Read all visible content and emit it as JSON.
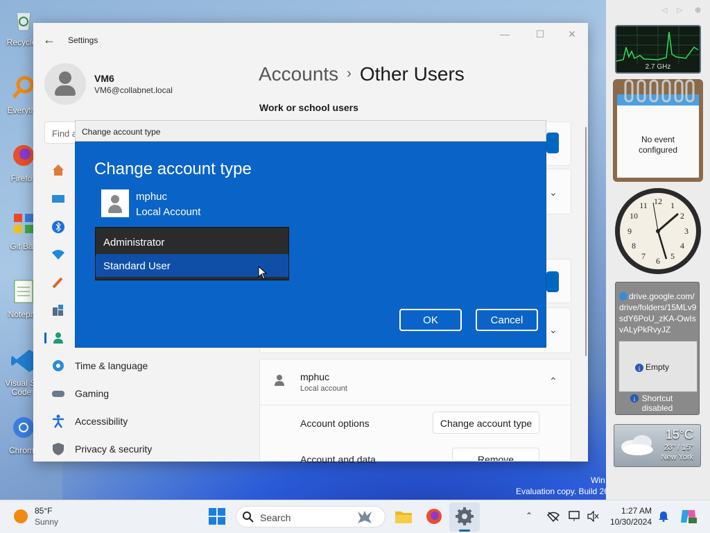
{
  "desktop": {
    "icons": [
      {
        "label": "Recycle",
        "color": "#e6e6e6"
      },
      {
        "label": "Everyth",
        "color": "#f08a12"
      },
      {
        "label": "Firefo",
        "color": "#e8502a"
      },
      {
        "label": "Git Ba",
        "color": "#3c7fd8"
      },
      {
        "label": "Notepa",
        "color": "#5aa03c"
      },
      {
        "label": "Visual St Code",
        "color": "#1e7fd0"
      },
      {
        "label": "Chrom",
        "color": "#3b7ee0"
      }
    ],
    "watermark_line1": "Win",
    "watermark_line2": "Evaluation copy. Build 26"
  },
  "window": {
    "title": "Settings",
    "controls": {
      "minimize": "—",
      "maximize": "☐",
      "close": "✕"
    },
    "user": {
      "name": "VM6",
      "email": "VM6@collabnet.local"
    },
    "find_placeholder": "Find a",
    "nav": [
      {
        "label": "Time & language",
        "icon": "globe-clock-icon"
      },
      {
        "label": "Gaming",
        "icon": "gamepad-icon"
      },
      {
        "label": "Accessibility",
        "icon": "accessibility-icon"
      },
      {
        "label": "Privacy & security",
        "icon": "shield-icon"
      }
    ],
    "breadcrumb": {
      "parent": "Accounts",
      "separator": "›",
      "current": "Other Users"
    },
    "section_title": "Work or school users",
    "user_row": {
      "name": "mphuc",
      "type": "Local account"
    },
    "account_options_label": "Account options",
    "change_type_btn": "Change account type",
    "account_data_label": "Account and data",
    "remove_btn": "Remove"
  },
  "dialog": {
    "title": "Change account type",
    "heading": "Change account type",
    "user_name": "mphuc",
    "user_type": "Local Account",
    "options": [
      "Administrator",
      "Standard User"
    ],
    "selected": "Standard User",
    "ok": "OK",
    "cancel": "Cancel",
    "accent": "#0a64c8"
  },
  "sidebar": {
    "nav": {
      "prev": "◁",
      "next": "▷",
      "add": "⊕"
    },
    "cpu": {
      "freq": "2.7 GHz"
    },
    "calendar": {
      "line1": "No event",
      "line2": "configured"
    },
    "drive": {
      "url": "drive.google.com/drive/folders/15MLv9sdY6PoU_zKA-OwIsvALyPkRvyJZ",
      "empty": "Empty",
      "shortcut_line1": "Shortcut",
      "shortcut_line2": "disabled"
    },
    "weather": {
      "temp": "15°C",
      "range": "23° / 15°",
      "city": "New York"
    }
  },
  "taskbar": {
    "weather": {
      "temp": "85°F",
      "desc": "Sunny"
    },
    "search_label": "Search",
    "time": "1:27 AM",
    "date": "10/30/2024"
  }
}
